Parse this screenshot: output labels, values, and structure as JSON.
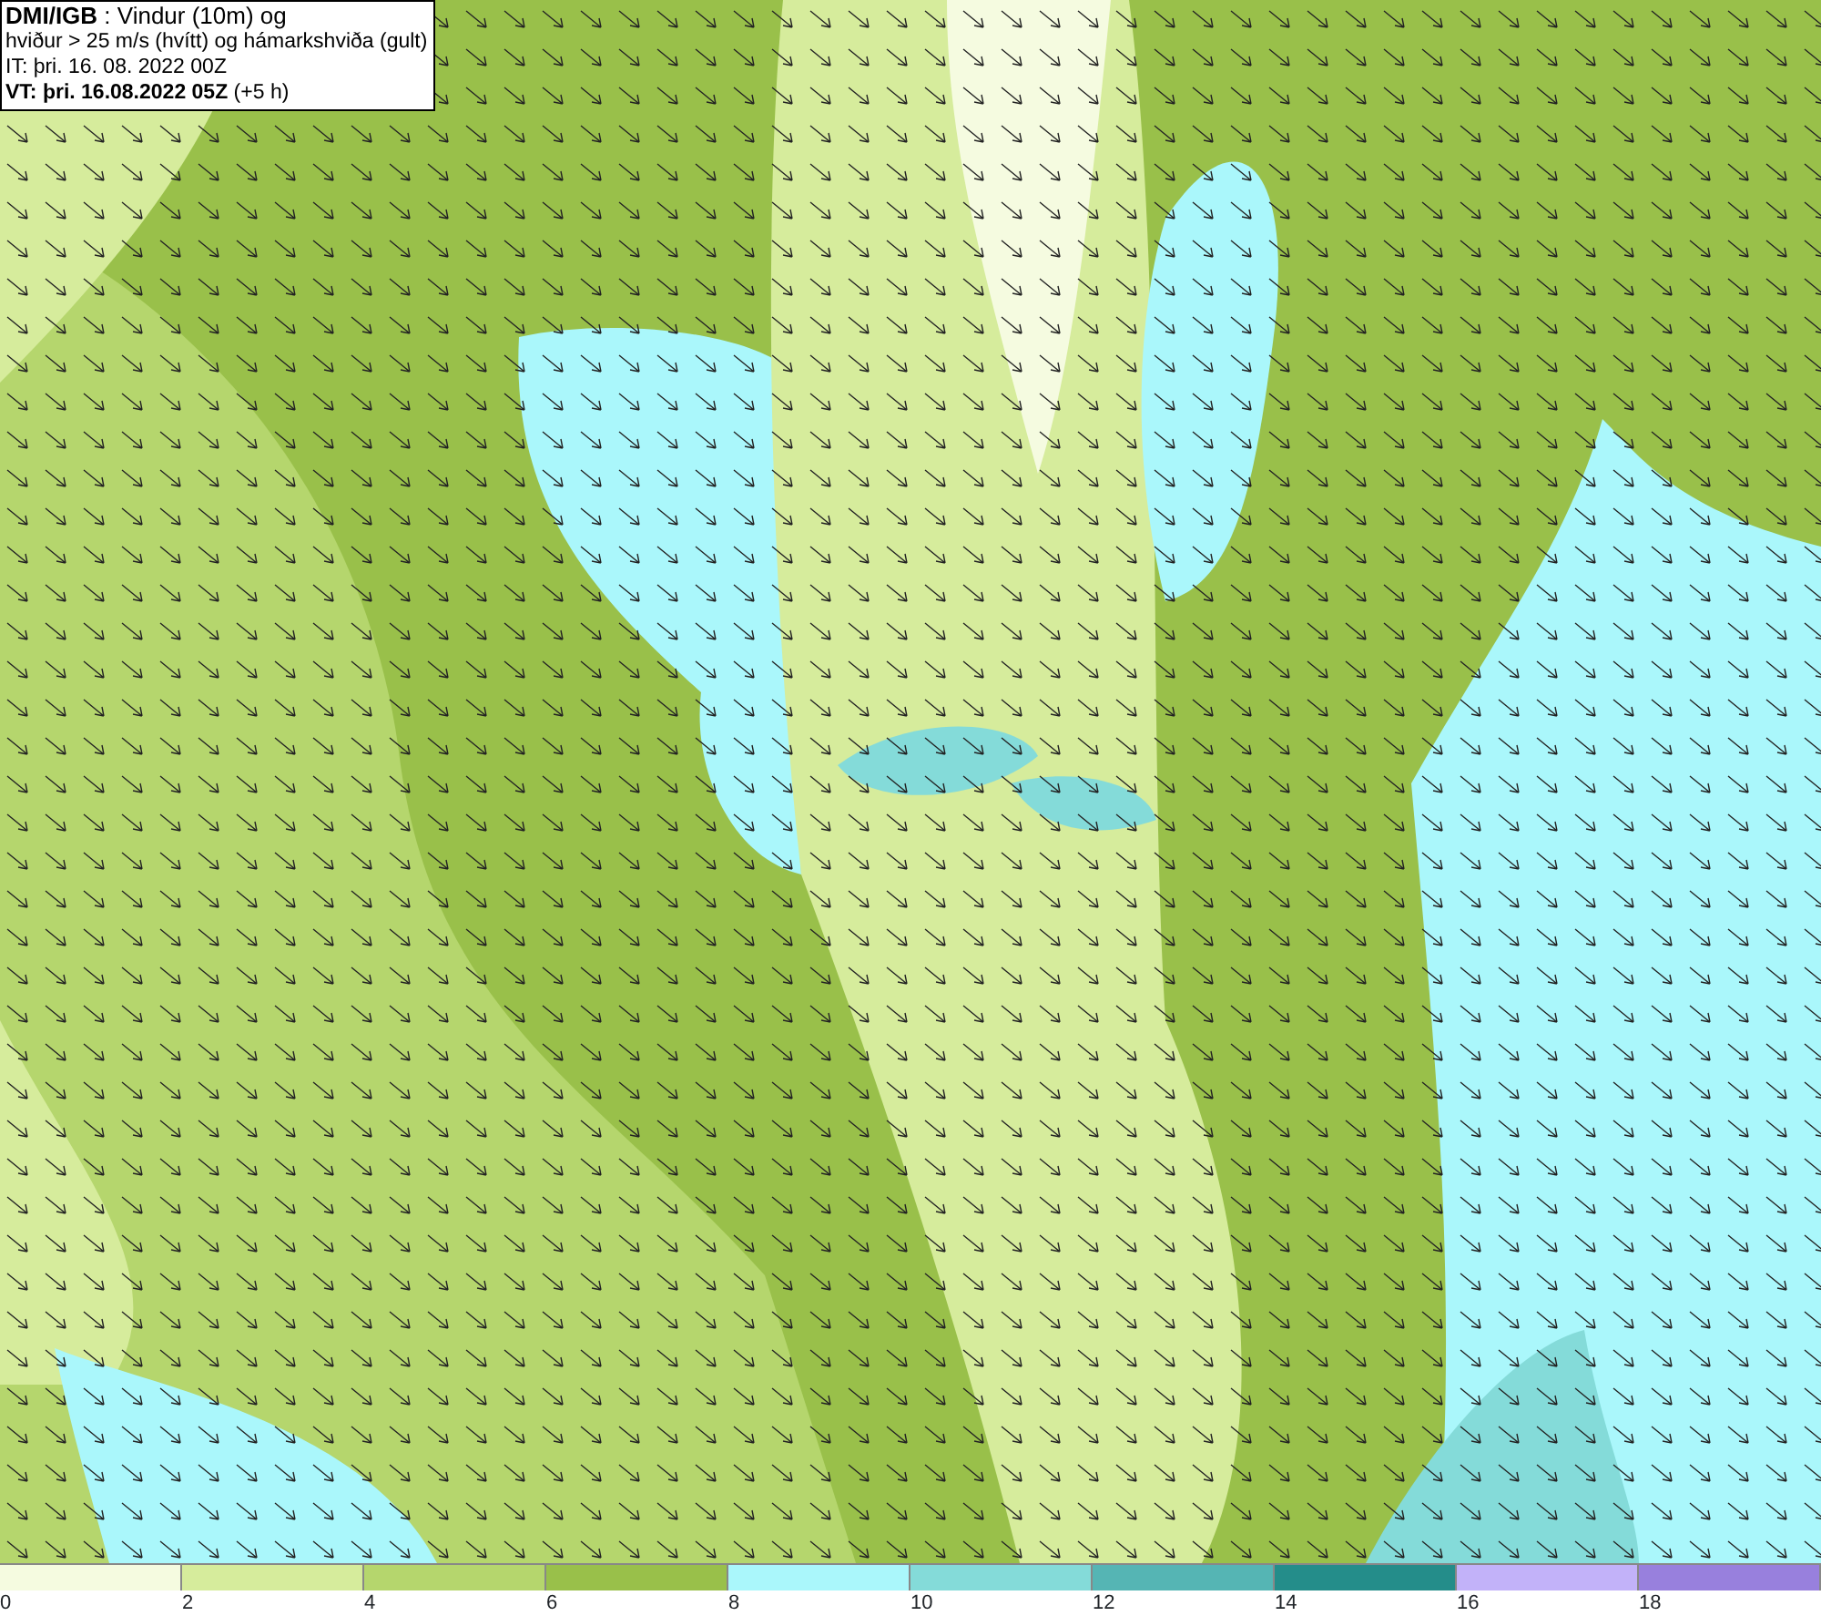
{
  "legend_box": {
    "lines": [
      "**DMI/IGB** : Vindur (10m) og",
      "hviður > 25 m/s (hvítt) og hámarkshviða (gult)",
      "IT: þri. 16. 08. 2022 00Z",
      "**VT: þri. 16.08.2022 05Z** (+5 h)"
    ]
  },
  "color_scale": {
    "bins": [
      {
        "color": "#f5fbe0"
      },
      {
        "color": "#d6ec9c"
      },
      {
        "color": "#b5d66d"
      },
      {
        "color": "#99c04a"
      },
      {
        "color": "#aaf7fb"
      },
      {
        "color": "#84dbd9"
      },
      {
        "color": "#55b5b4"
      },
      {
        "color": "#248d8a"
      },
      {
        "color": "#c2b2f9"
      },
      {
        "color": "#9880dd"
      }
    ],
    "tick_labels": [
      "0",
      "2",
      "4",
      "6",
      "8",
      "10",
      "12",
      "14",
      "16",
      "18"
    ]
  }
}
